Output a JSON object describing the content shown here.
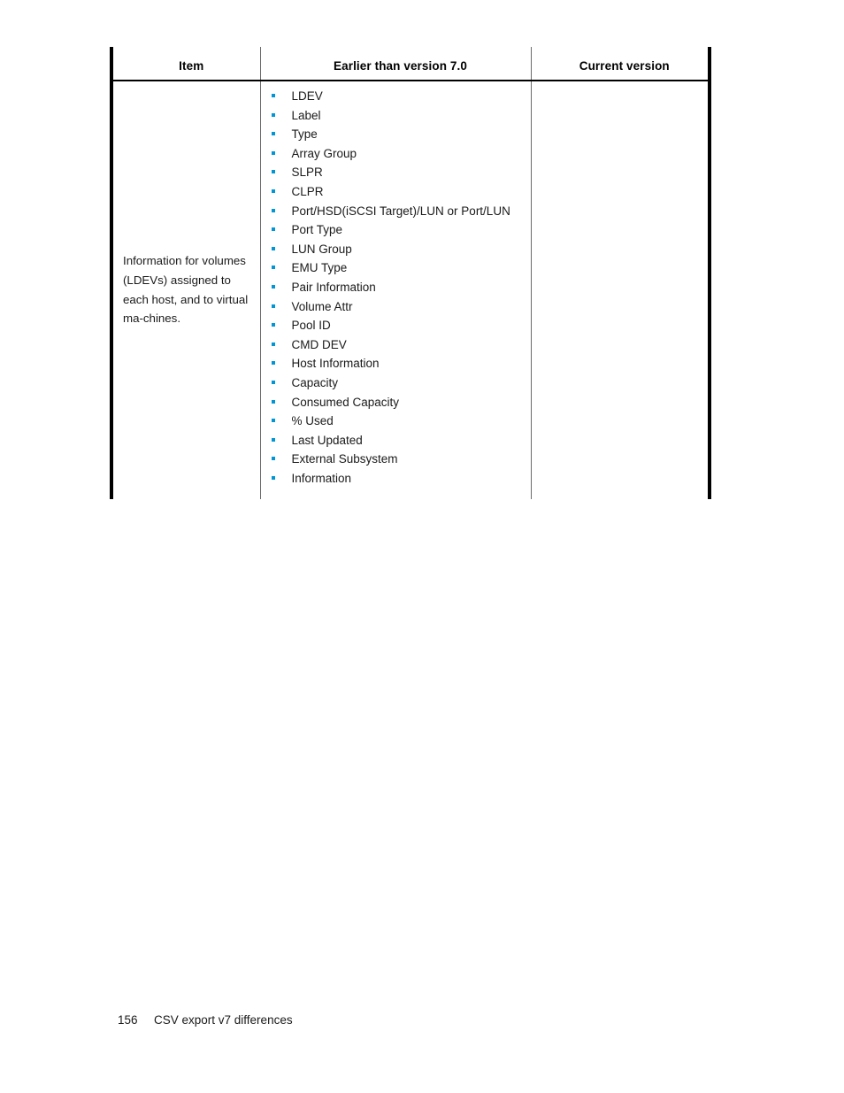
{
  "document": {
    "table": {
      "columns": [
        {
          "key": "item",
          "header": "Item"
        },
        {
          "key": "earlier",
          "header": "Earlier than version 7.0"
        },
        {
          "key": "current",
          "header": "Current version"
        }
      ],
      "rows": [
        {
          "item": "Information for volumes (LDEVs) assigned to each host, and to virtual ma-chines.",
          "earlier_bullets": [
            "LDEV",
            "Label",
            "Type",
            "Array Group",
            "SLPR",
            "CLPR",
            "Port/HSD(iSCSI Target)/LUN or Port/LUN",
            "Port Type",
            "LUN Group",
            "EMU Type",
            "Pair Information",
            "Volume Attr",
            "Pool ID",
            "CMD DEV",
            "Host Information",
            "Capacity",
            "Consumed Capacity",
            "% Used",
            "Last Updated",
            "External Subsystem",
            "Information"
          ],
          "current": ""
        }
      ]
    },
    "footer": {
      "page_number": "156",
      "title": "CSV export v7 differences"
    },
    "colors": {
      "bullet": "#0096d6",
      "text": "#1a1a1a",
      "rule_heavy": "#000000",
      "rule_light": "#6b6b6b"
    }
  }
}
